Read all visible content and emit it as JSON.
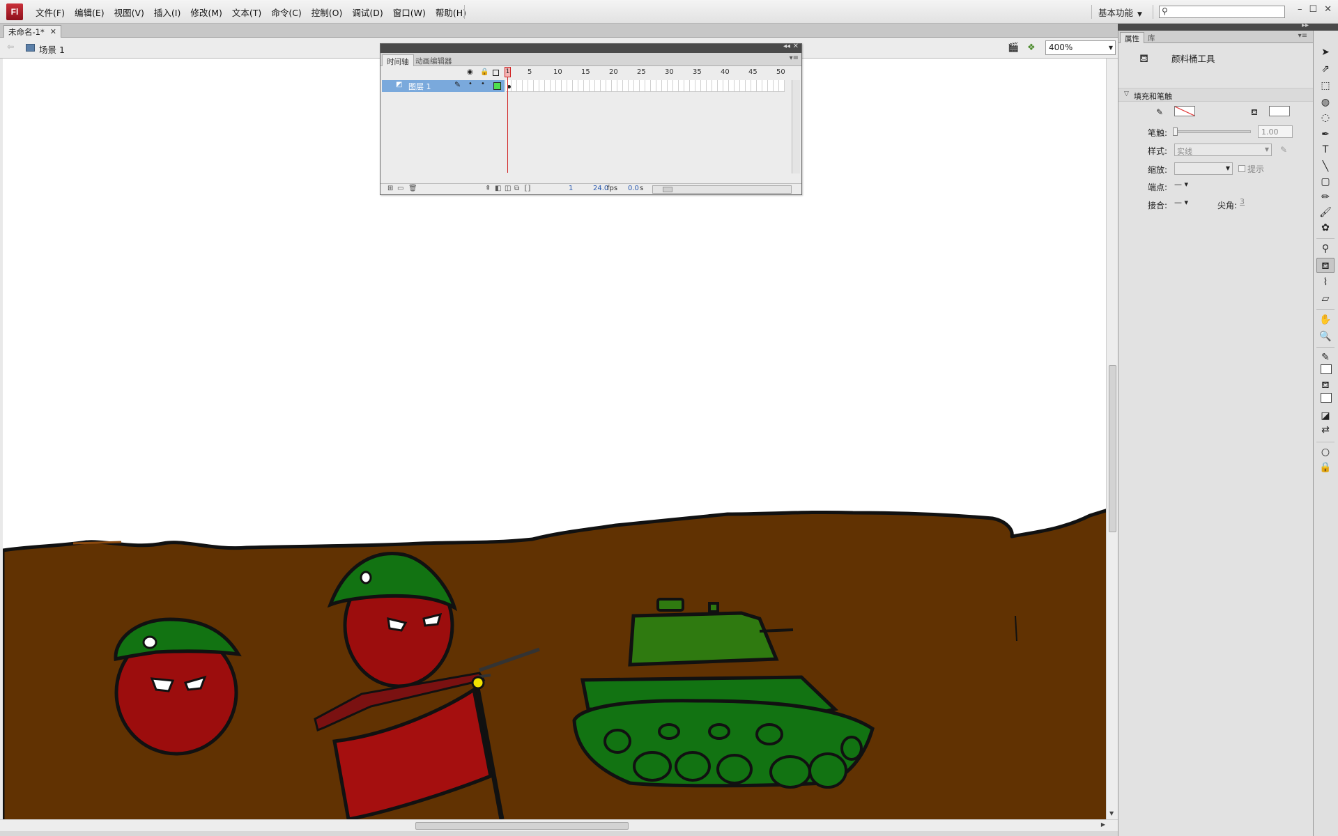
{
  "app": {
    "logo": "Fl",
    "menus": [
      "文件(F)",
      "编辑(E)",
      "视图(V)",
      "插入(I)",
      "修改(M)",
      "文本(T)",
      "命令(C)",
      "控制(O)",
      "调试(D)",
      "窗口(W)",
      "帮助(H)"
    ],
    "workspace": "基本功能",
    "search_placeholder": "",
    "window_controls": [
      "–",
      "☐",
      "✕"
    ]
  },
  "document": {
    "tab_title": "未命名-1*",
    "scene": "场景 1",
    "zoom": "400%"
  },
  "timeline": {
    "tabs": [
      "时间轴",
      "动画编辑器"
    ],
    "frame_numbers": [
      "1",
      "5",
      "10",
      "15",
      "20",
      "25",
      "30",
      "35",
      "40",
      "45",
      "50"
    ],
    "layer": {
      "name": "图层 1",
      "color": "#4ee04e"
    },
    "current_frame": "1",
    "fps": "24.0",
    "fps_unit": "fps",
    "time": "0.0",
    "time_unit": "s"
  },
  "properties": {
    "tabs": [
      "属性",
      "库"
    ],
    "tool_name": "颜料桶工具",
    "section": "填充和笔触",
    "stroke_label": "笔触:",
    "stroke_value": "1.00",
    "style_label": "样式:",
    "style_value": "实线",
    "scale_label": "缩放:",
    "hint_label": "提示",
    "cap_label": "端点:",
    "cap_value": "—",
    "join_label": "接合:",
    "join_value": "—",
    "miter_label": "尖角:",
    "miter_value": "3"
  },
  "toolbox": {
    "tools": [
      "selection-tool",
      "subselection-tool",
      "free-transform-tool",
      "3d-rotation-tool",
      "lasso-tool",
      "pen-tool",
      "text-tool",
      "line-tool",
      "rectangle-tool",
      "pencil-tool",
      "brush-tool",
      "deco-tool",
      "bone-tool",
      "paint-bucket-tool",
      "eyedropper-tool",
      "eraser-tool",
      "hand-tool",
      "zoom-tool"
    ],
    "active_tool": "paint-bucket-tool"
  },
  "colors": {
    "ground": "#613202",
    "ball_red": "#9c0d0d",
    "helmet_green": "#127312",
    "tank_green": "#2f7a10",
    "flag_red": "#a50f0f",
    "rifle": "#7a1111"
  }
}
